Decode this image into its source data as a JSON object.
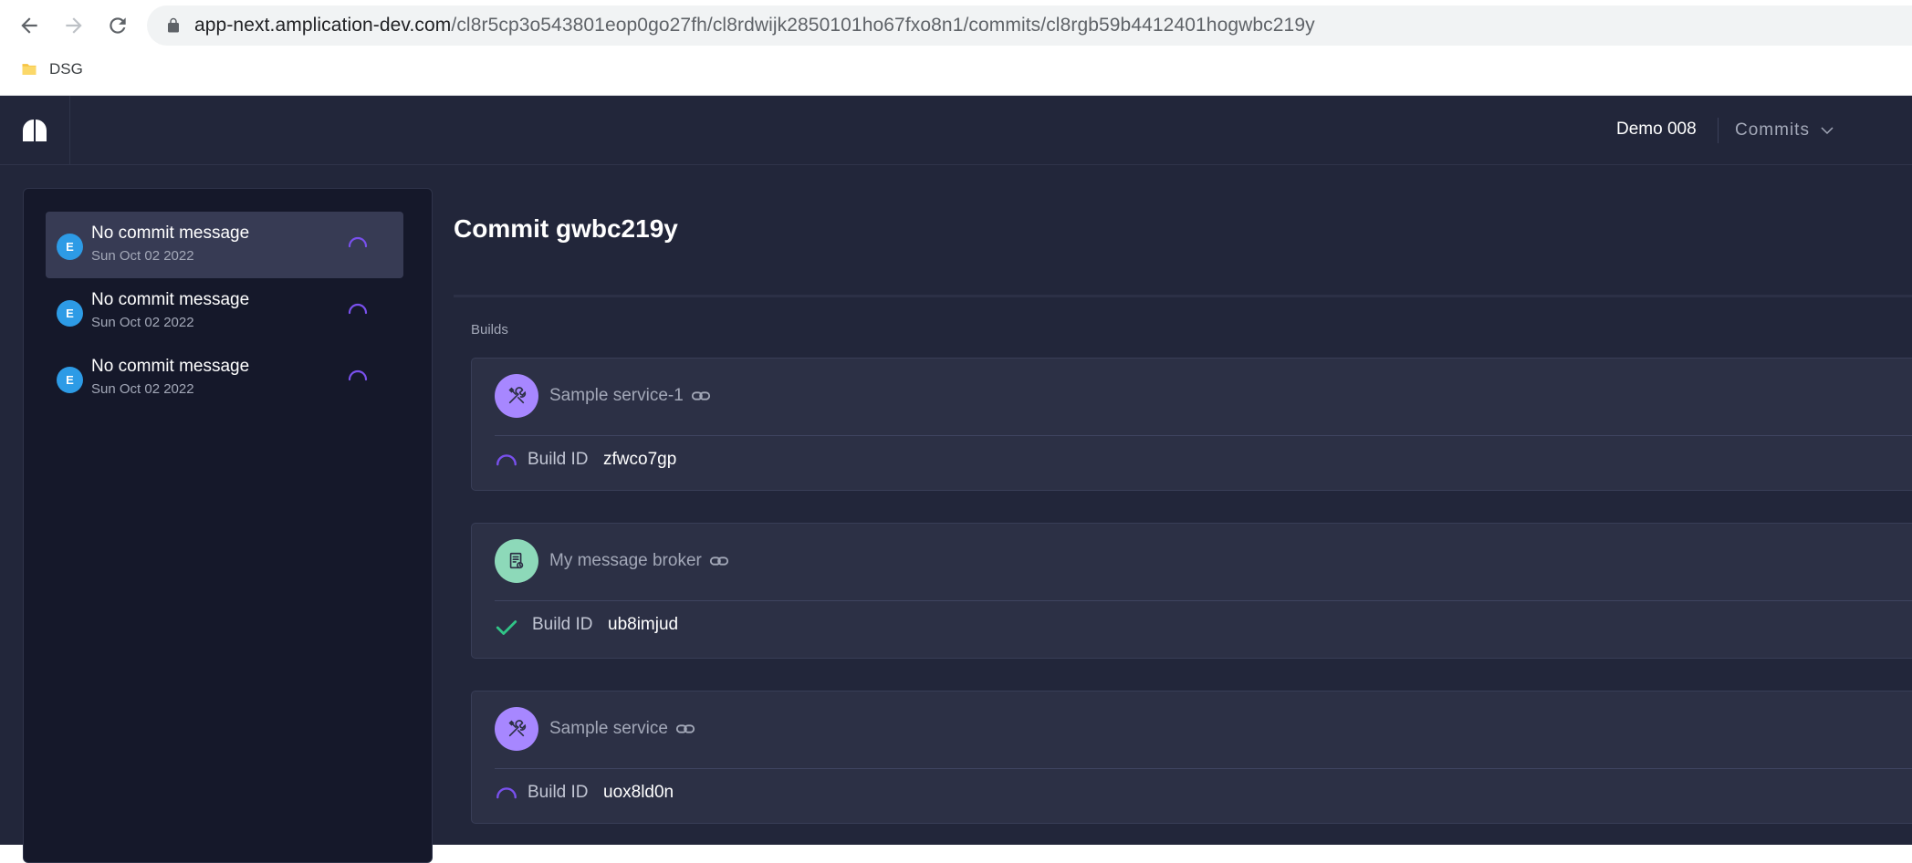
{
  "browser": {
    "url_host": "app-next.amplication-dev.com",
    "url_path": "/cl8r5cp3o543801eop0go27fh/cl8rdwijk2850101ho67fxo8n1/commits/cl8rgb59b4412401hogwbc219y",
    "bookmarks": [
      {
        "label": "DSG"
      }
    ]
  },
  "header": {
    "workspace": "Demo 008",
    "menu_label": "Commits"
  },
  "sidebar": {
    "commits": [
      {
        "avatar": "E",
        "message": "No commit message",
        "date": "Sun Oct 02 2022",
        "selected": true
      },
      {
        "avatar": "E",
        "message": "No commit message",
        "date": "Sun Oct 02 2022",
        "selected": false
      },
      {
        "avatar": "E",
        "message": "No commit message",
        "date": "Sun Oct 02 2022",
        "selected": false
      }
    ]
  },
  "main": {
    "title": "Commit gwbc219y",
    "builds_label": "Builds",
    "builds": [
      {
        "name": "Sample service-1",
        "icon": "tools-icon",
        "icon_color": "#a787ff",
        "status": "in-progress",
        "build_id_label": "Build ID",
        "build_id": "zfwco7gp"
      },
      {
        "name": "My message broker",
        "icon": "message-broker-icon",
        "icon_color": "#8dd9b9",
        "status": "completed",
        "build_id_label": "Build ID",
        "build_id": "ub8imjud"
      },
      {
        "name": "Sample service",
        "icon": "tools-icon",
        "icon_color": "#a787ff",
        "status": "in-progress",
        "build_id_label": "Build ID",
        "build_id": "uox8ld0n"
      }
    ]
  },
  "colors": {
    "accent": "#7950ed",
    "success": "#31c587",
    "avatar": "#2d9be6"
  }
}
